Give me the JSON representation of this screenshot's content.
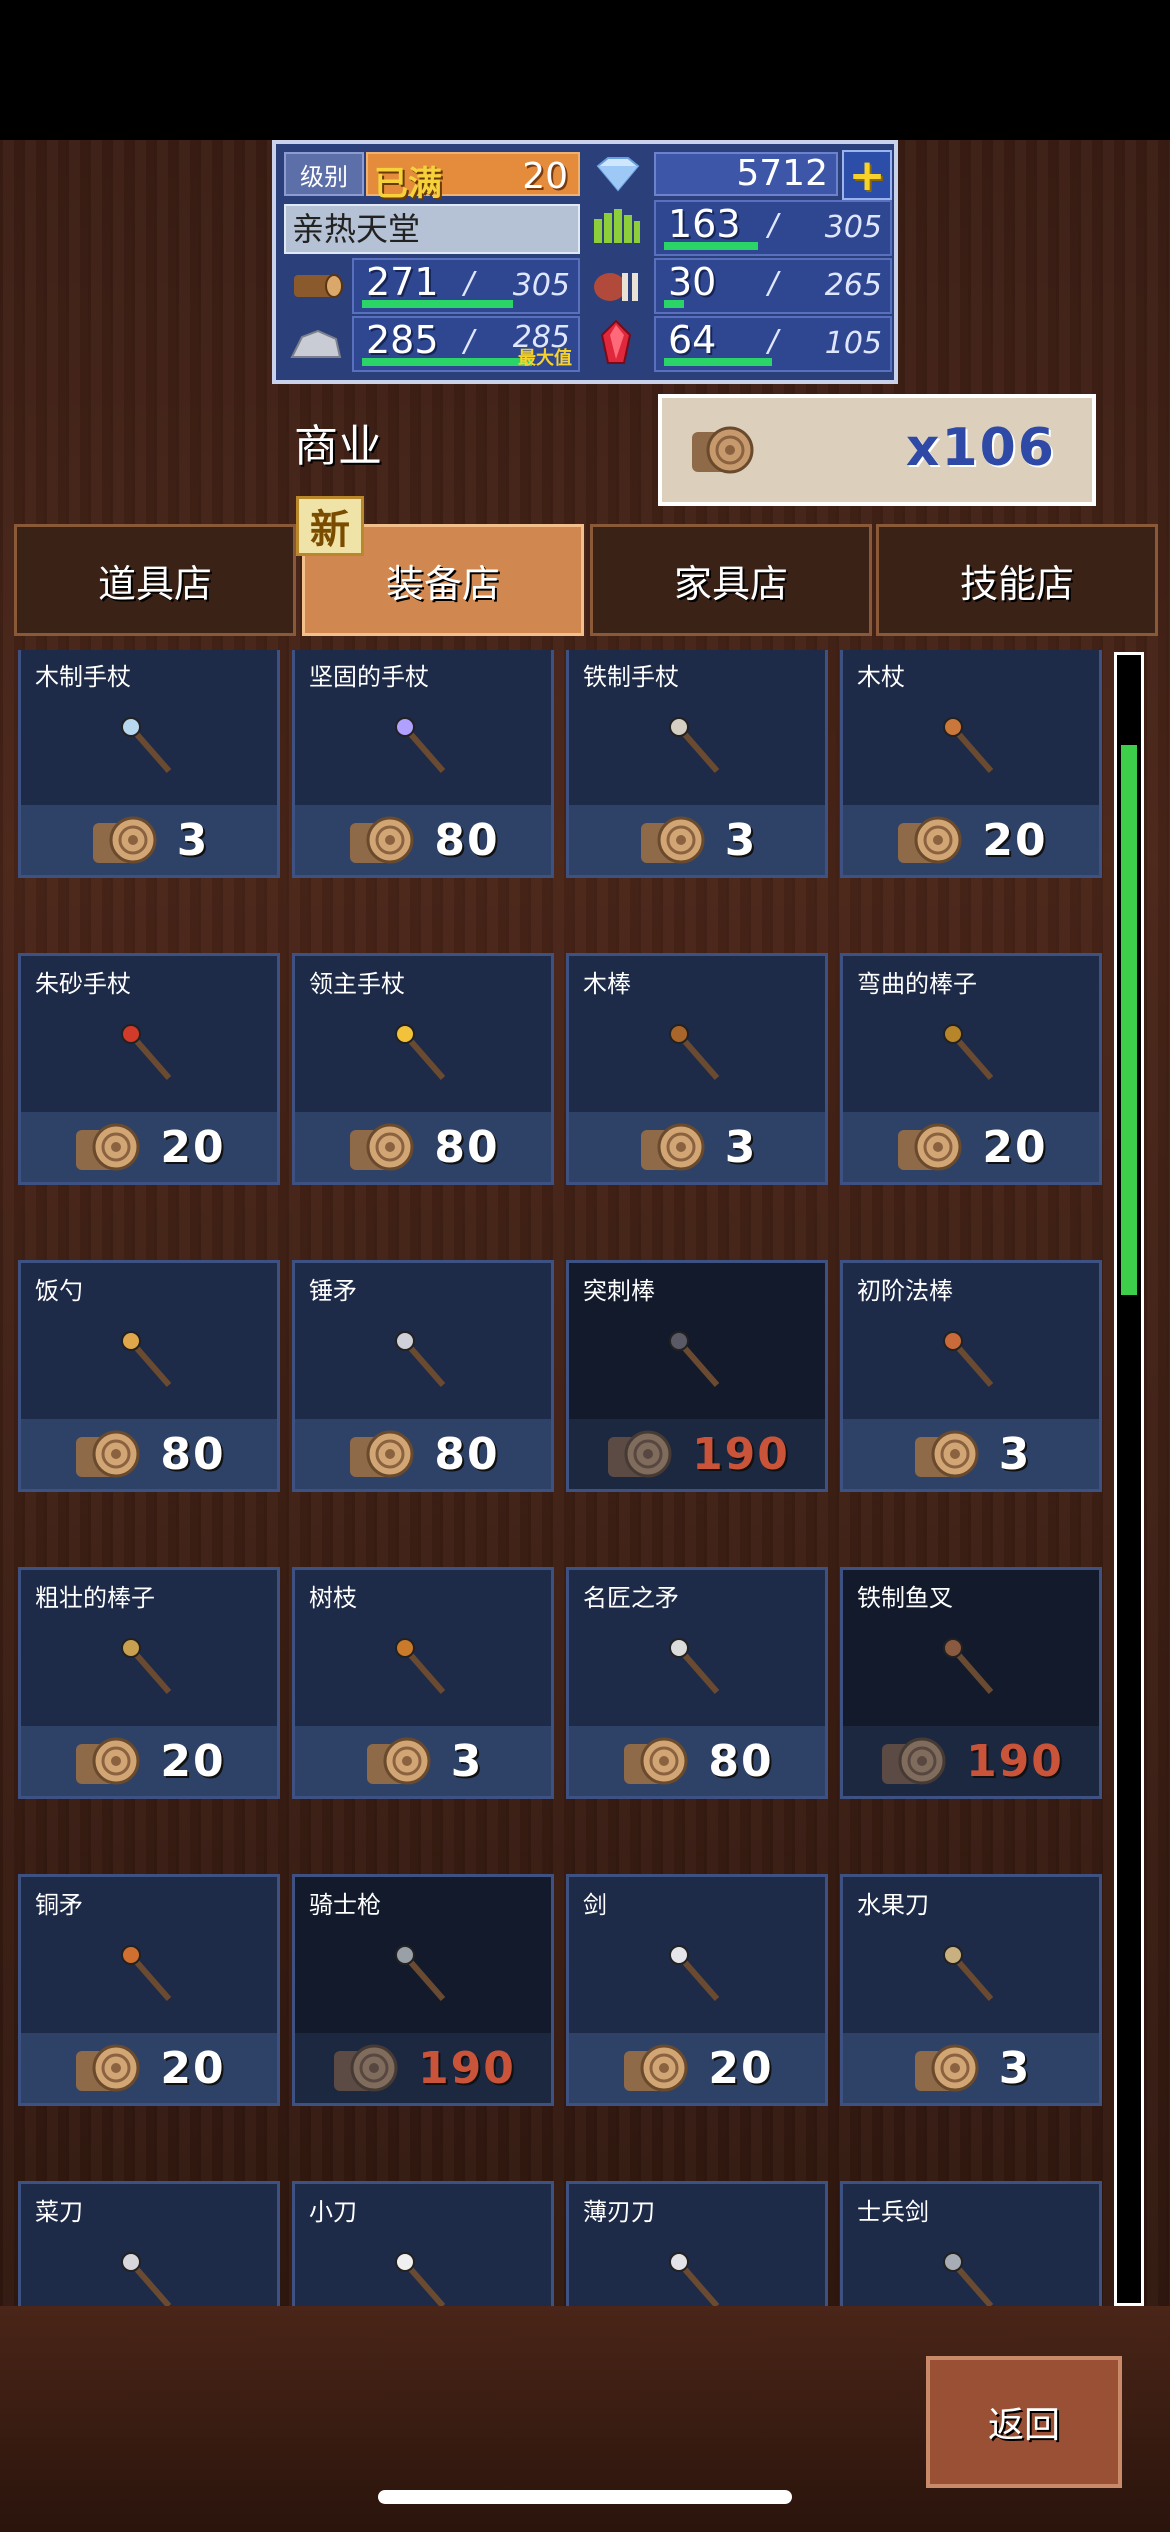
{
  "status": {
    "level_label": "级别",
    "level_full": "已满",
    "level": "20",
    "gems": "5712",
    "plus": "+",
    "name": "亲热天堂",
    "resources": {
      "grass": {
        "current": "163",
        "max": "305",
        "fill": 0.53
      },
      "wood": {
        "current": "271",
        "max": "305",
        "fill": 0.89
      },
      "meat": {
        "current": "30",
        "max": "265",
        "fill": 0.11
      },
      "stone": {
        "current": "285",
        "max": "285",
        "fill": 1.0,
        "tag": "最大值"
      },
      "ruby": {
        "current": "64",
        "max": "105",
        "fill": 0.61
      }
    },
    "separator": "/"
  },
  "commerce": {
    "title": "商业",
    "currency_amount": "x106",
    "new_badge": "新"
  },
  "tabs": [
    {
      "label": "道具店",
      "active": false
    },
    {
      "label": "装备店",
      "active": true
    },
    {
      "label": "家具店",
      "active": false
    },
    {
      "label": "技能店",
      "active": false
    }
  ],
  "items": [
    {
      "name": "木制手杖",
      "price": "3",
      "icon": "wooden-cane-icon",
      "affordable": true
    },
    {
      "name": "坚固的手杖",
      "price": "80",
      "icon": "sturdy-cane-icon",
      "affordable": true
    },
    {
      "name": "铁制手杖",
      "price": "3",
      "icon": "iron-cane-icon",
      "affordable": true
    },
    {
      "name": "木杖",
      "price": "20",
      "icon": "wood-staff-icon",
      "affordable": true
    },
    {
      "name": "朱砂手杖",
      "price": "20",
      "icon": "cinnabar-cane-icon",
      "affordable": true
    },
    {
      "name": "领主手杖",
      "price": "80",
      "icon": "lord-cane-icon",
      "affordable": true
    },
    {
      "name": "木棒",
      "price": "3",
      "icon": "wood-club-icon",
      "affordable": true
    },
    {
      "name": "弯曲的棒子",
      "price": "20",
      "icon": "bent-stick-icon",
      "affordable": true
    },
    {
      "name": "饭勺",
      "price": "80",
      "icon": "rice-ladle-icon",
      "affordable": true
    },
    {
      "name": "锤矛",
      "price": "80",
      "icon": "mace-icon",
      "affordable": true
    },
    {
      "name": "突刺棒",
      "price": "190",
      "icon": "spiked-club-icon",
      "affordable": false
    },
    {
      "name": "初阶法棒",
      "price": "3",
      "icon": "novice-wand-icon",
      "affordable": true
    },
    {
      "name": "粗壮的棒子",
      "price": "20",
      "icon": "thick-stick-icon",
      "affordable": true
    },
    {
      "name": "树枝",
      "price": "3",
      "icon": "branch-icon",
      "affordable": true
    },
    {
      "name": "名匠之矛",
      "price": "80",
      "icon": "master-spear-icon",
      "affordable": true
    },
    {
      "name": "铁制鱼叉",
      "price": "190",
      "icon": "iron-harpoon-icon",
      "affordable": false
    },
    {
      "name": "铜矛",
      "price": "20",
      "icon": "copper-spear-icon",
      "affordable": true
    },
    {
      "name": "骑士枪",
      "price": "190",
      "icon": "knight-lance-icon",
      "affordable": false
    },
    {
      "name": "剑",
      "price": "20",
      "icon": "sword-icon",
      "affordable": true
    },
    {
      "name": "水果刀",
      "price": "3",
      "icon": "fruit-knife-icon",
      "affordable": true
    },
    {
      "name": "菜刀",
      "price": "",
      "icon": "kitchen-knife-icon",
      "affordable": true
    },
    {
      "name": "小刀",
      "price": "",
      "icon": "small-knife-icon",
      "affordable": true
    },
    {
      "name": "薄刃刀",
      "price": "",
      "icon": "thin-blade-icon",
      "affordable": true
    },
    {
      "name": "士兵剑",
      "price": "",
      "icon": "soldier-sword-icon",
      "affordable": true
    }
  ],
  "back_label": "返回",
  "colors": {
    "tab_active": "#d08850",
    "price_unaffordable": "#c9543a",
    "scroll_thumb": "#3ecf4a",
    "gauge_fill": "#2bd466"
  }
}
